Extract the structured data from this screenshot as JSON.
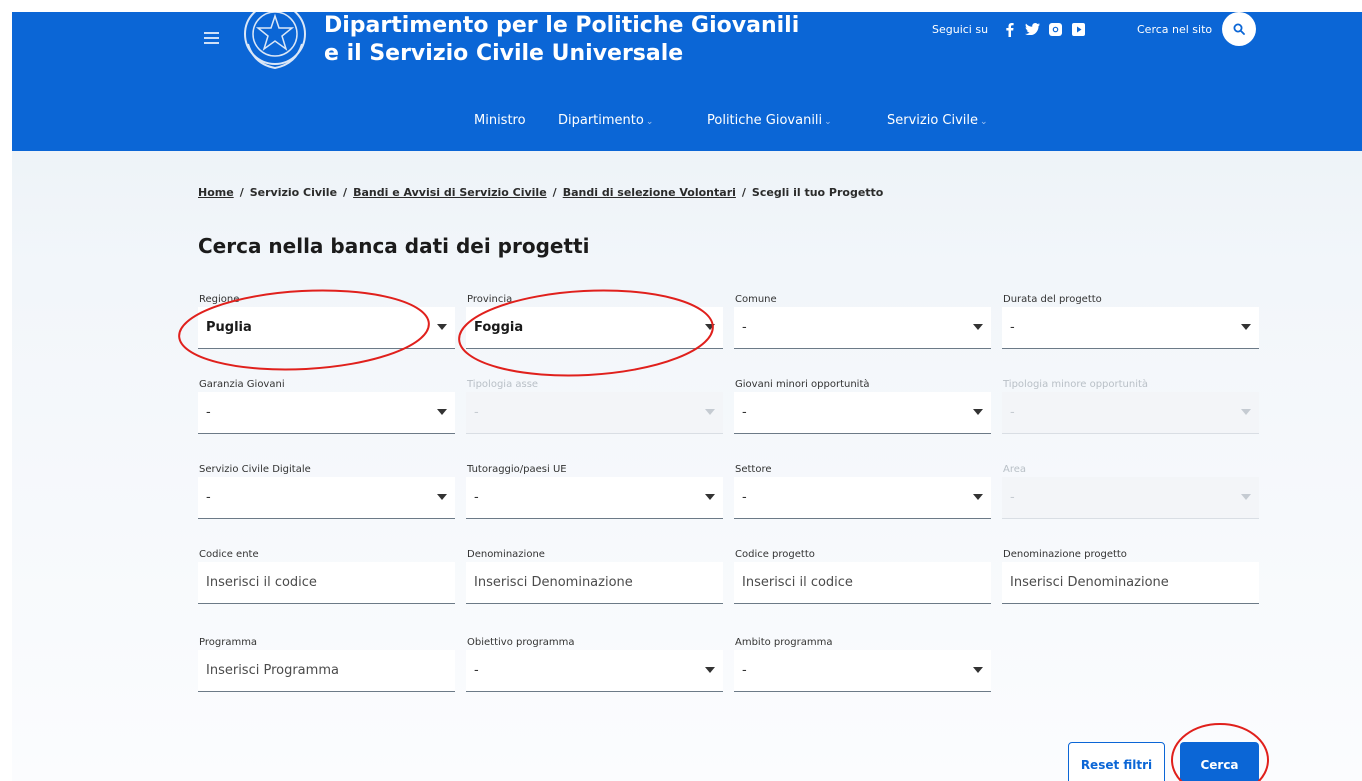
{
  "header": {
    "title_line1": "Dipartimento per le Politiche Giovanili",
    "title_line2": "e il Servizio Civile Universale",
    "follow_label": "Seguici su",
    "search_label": "Cerca nel sito",
    "social_icons": [
      "facebook-icon",
      "twitter-icon",
      "instagram-icon",
      "youtube-icon"
    ]
  },
  "nav": {
    "items": [
      {
        "label": "Ministro",
        "dropdown": false
      },
      {
        "label": "Dipartimento",
        "dropdown": true
      },
      {
        "label": "Politiche Giovanili",
        "dropdown": true
      },
      {
        "label": "Servizio Civile",
        "dropdown": true
      }
    ],
    "chevron": "⌄"
  },
  "breadcrumb": {
    "items": [
      "Home",
      "Servizio Civile",
      "Bandi e Avvisi di Servizio Civile",
      "Bandi di selezione Volontari",
      "Scegli il tuo Progetto"
    ],
    "separator": "/"
  },
  "page_title": "Cerca nella banca dati dei progetti",
  "form": {
    "regione": {
      "label": "Regione",
      "value": "Puglia"
    },
    "provincia": {
      "label": "Provincia",
      "value": "Foggia"
    },
    "comune": {
      "label": "Comune",
      "value": "-"
    },
    "durata": {
      "label": "Durata del progetto",
      "value": "-"
    },
    "garanzia": {
      "label": "Garanzia Giovani",
      "value": "-"
    },
    "tipologia_asse": {
      "label": "Tipologia asse",
      "value": "-"
    },
    "giovani_minori": {
      "label": "Giovani minori opportunità",
      "value": "-"
    },
    "tipologia_minore": {
      "label": "Tipologia minore opportunità",
      "value": "-"
    },
    "digitale": {
      "label": "Servizio Civile Digitale",
      "value": "-"
    },
    "tutoraggio": {
      "label": "Tutoraggio/paesi UE",
      "value": "-"
    },
    "settore": {
      "label": "Settore",
      "value": "-"
    },
    "area": {
      "label": "Area",
      "value": "-"
    },
    "codice_ente": {
      "label": "Codice ente",
      "placeholder": "Inserisci il codice"
    },
    "denominazione": {
      "label": "Denominazione",
      "placeholder": "Inserisci Denominazione"
    },
    "codice_progetto": {
      "label": "Codice progetto",
      "placeholder": "Inserisci il codice"
    },
    "denominazione_progetto": {
      "label": "Denominazione progetto",
      "placeholder": "Inserisci Denominazione"
    },
    "programma": {
      "label": "Programma",
      "placeholder": "Inserisci Programma"
    },
    "obiettivo_programma": {
      "label": "Obiettivo programma",
      "value": "-"
    },
    "ambito_programma": {
      "label": "Ambito programma",
      "value": "-"
    }
  },
  "buttons": {
    "reset": "Reset filtri",
    "search": "Cerca"
  },
  "colors": {
    "brand_blue": "#0b66d6",
    "annotation_red": "#e0201c"
  }
}
